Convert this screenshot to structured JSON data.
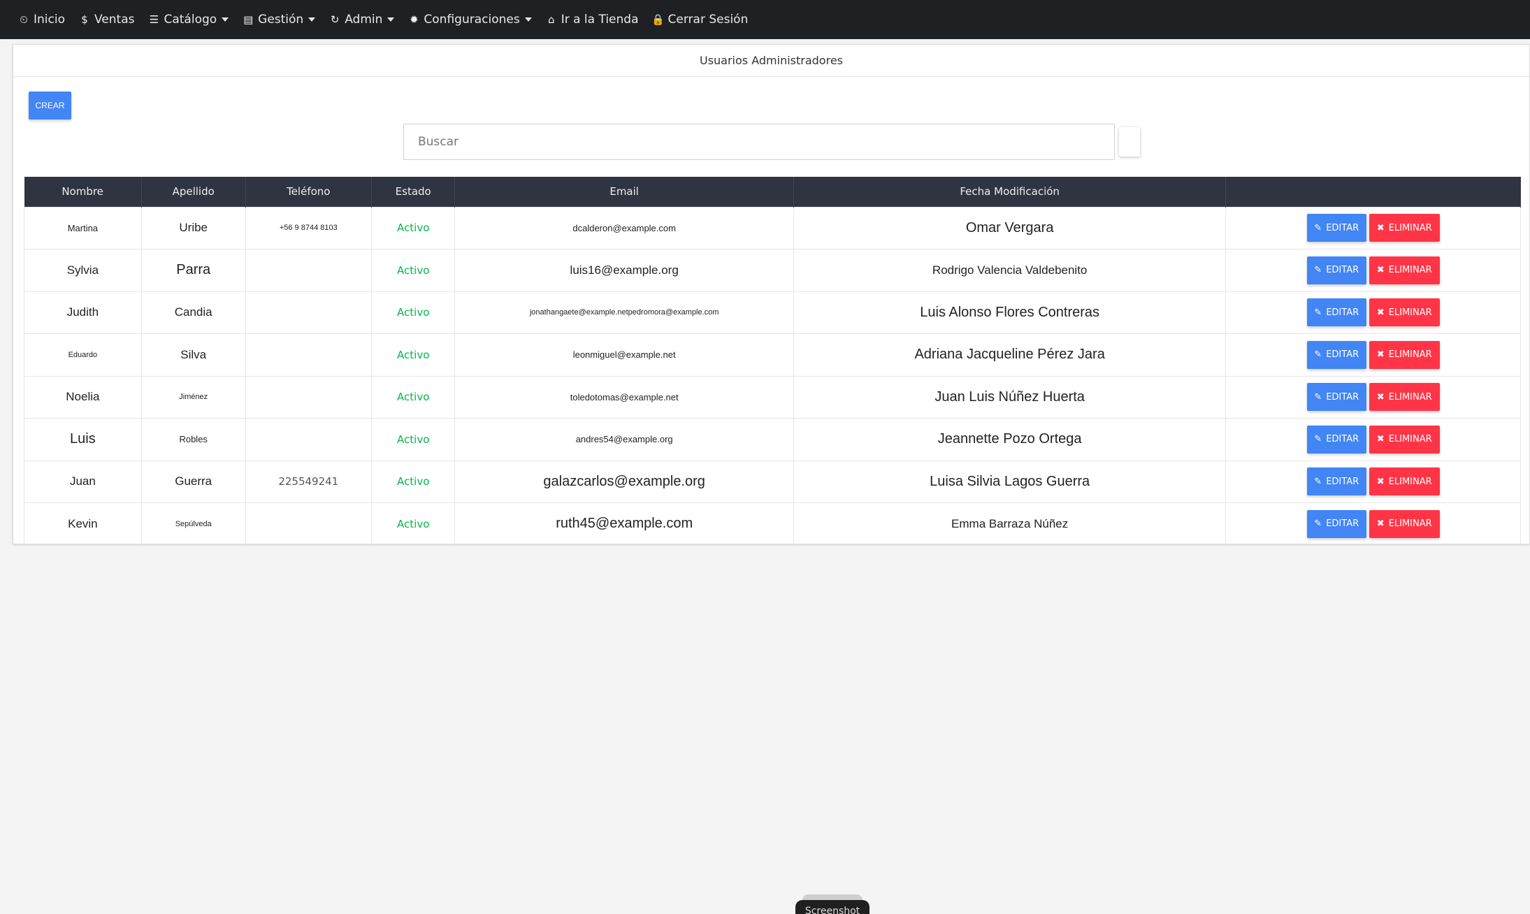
{
  "nav": {
    "items": [
      {
        "label": "Inicio",
        "icon": "dashboard-icon",
        "glyph": "⏲",
        "dropdown": false
      },
      {
        "label": "Ventas",
        "icon": "dollar-icon",
        "glyph": "$",
        "dropdown": false
      },
      {
        "label": "Catálogo",
        "icon": "list-icon",
        "glyph": "☰",
        "dropdown": true
      },
      {
        "label": "Gestión",
        "icon": "keyboard-icon",
        "glyph": "▤",
        "dropdown": true
      },
      {
        "label": "Admin",
        "icon": "refresh-icon",
        "glyph": "↻",
        "dropdown": true
      },
      {
        "label": "Configuraciones",
        "icon": "gear-icon",
        "glyph": "✹",
        "dropdown": true
      },
      {
        "label": "Ir a la Tienda",
        "icon": "home-icon",
        "glyph": "⌂",
        "dropdown": false
      },
      {
        "label": "Cerrar Sesión",
        "icon": "lock-icon",
        "glyph": "🔒",
        "dropdown": false
      }
    ]
  },
  "card": {
    "title": "Usuarios Administradores",
    "create_label": "CREAR",
    "search_placeholder": "Buscar"
  },
  "table": {
    "headers": [
      "Nombre",
      "Apellido",
      "Teléfono",
      "Estado",
      "Email",
      "Fecha Modificación",
      ""
    ],
    "edit_label": "EDITAR",
    "delete_label": "ELIMINAR",
    "rows": [
      {
        "nombre": "Martina",
        "apellido": "Uribe",
        "telefono": "+56 9 8744 8103",
        "estado": "Activo",
        "email": "dcalderon@example.com",
        "fecha": "Omar Vergara"
      },
      {
        "nombre": "Sylvia",
        "apellido": "Parra",
        "telefono": "",
        "estado": "Activo",
        "email": "luis16@example.org",
        "fecha": "Rodrigo Valencia Valdebenito"
      },
      {
        "nombre": "Judith",
        "apellido": "Candia",
        "telefono": "",
        "estado": "Activo",
        "email": "jonathangaete@example.netpedromora@example.com",
        "fecha": "Luis Alonso Flores Contreras"
      },
      {
        "nombre": "Eduardo",
        "apellido": "Silva",
        "telefono": "",
        "estado": "Activo",
        "email": "leonmiguel@example.net",
        "fecha": "Adriana Jacqueline Pérez Jara"
      },
      {
        "nombre": "Noelia",
        "apellido": "Jiménez",
        "telefono": "",
        "estado": "Activo",
        "email": "toledotomas@example.net",
        "fecha": "Juan Luis Núñez Huerta"
      },
      {
        "nombre": "Luis",
        "apellido": "Robles",
        "telefono": "",
        "estado": "Activo",
        "email": "andres54@example.org",
        "fecha": "Jeannette Pozo Ortega"
      },
      {
        "nombre": "Juan",
        "apellido": "Guerra",
        "telefono": "225549241",
        "estado": "Activo",
        "email": "galazcarlos@example.org",
        "fecha": "Luisa Silvia Lagos Guerra"
      },
      {
        "nombre": "Kevin",
        "apellido": "Sepúlveda",
        "telefono": "",
        "estado": "Activo",
        "email": "ruth45@example.com",
        "fecha": "Emma Barraza Núñez"
      }
    ]
  },
  "tooltip": {
    "label": "Screenshot"
  },
  "colors": {
    "navbar": "#1f2023",
    "primary": "#4285f4",
    "danger": "#ff3547",
    "success": "#00b74a",
    "table_header": "#2e3440"
  }
}
